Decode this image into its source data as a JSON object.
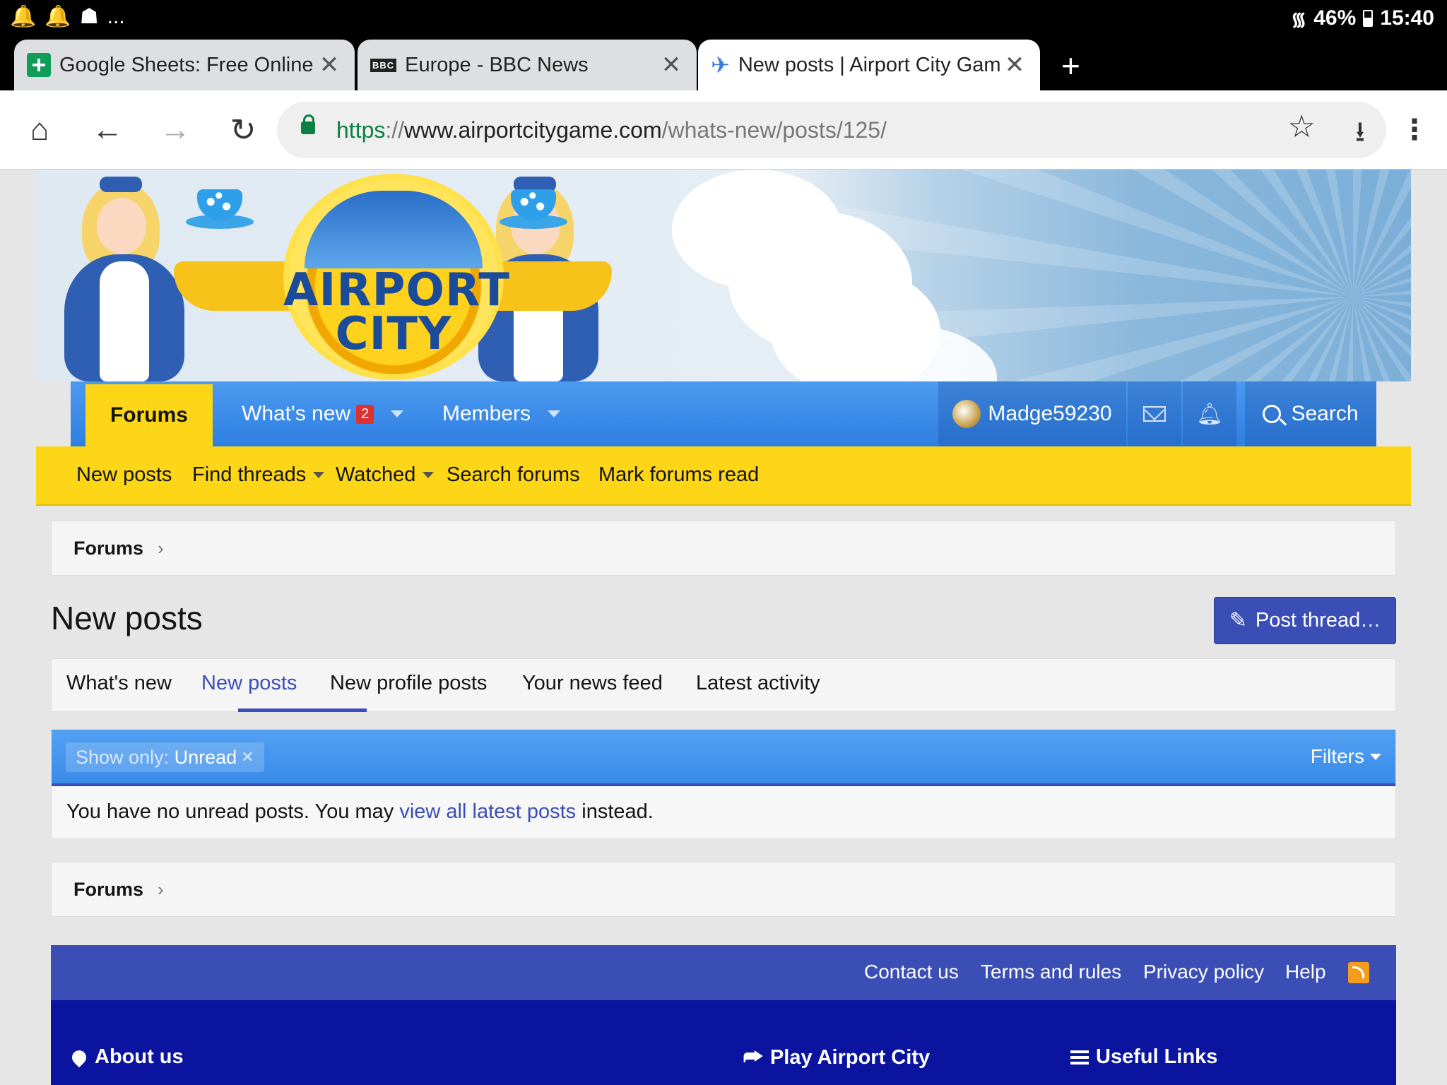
{
  "status_bar": {
    "left_icons": [
      "notification-bell-icon",
      "notification-bell-icon",
      "app-notification-icon"
    ],
    "more": "...",
    "battery": "46%",
    "time": "15:40"
  },
  "tabs": [
    {
      "title": "Google Sheets: Free Online S",
      "favicon": "sheets-icon"
    },
    {
      "title": "Europe - BBC News",
      "favicon": "bbc-icon",
      "favicon_text": "BBC"
    },
    {
      "title": "New posts | Airport City Gam",
      "favicon": "plane-icon"
    }
  ],
  "toolbar": {
    "url_scheme": "https",
    "url_sep": "://",
    "url_host": "www.airportcitygame.com",
    "url_path": "/whats-new/posts/125/"
  },
  "banner": {
    "logo_line1": "AIRPORT",
    "logo_line2": "CITY"
  },
  "nav": {
    "forums": "Forums",
    "whats_new": "What's new",
    "whats_new_badge": "2",
    "members": "Members",
    "username": "Madge59230",
    "search": "Search"
  },
  "subnav": {
    "new_posts": "New posts",
    "find_threads": "Find threads",
    "watched": "Watched",
    "search_forums": "Search forums",
    "mark_read": "Mark forums read"
  },
  "breadcrumb": {
    "label": "Forums"
  },
  "page": {
    "title": "New posts",
    "post_thread": "Post thread…"
  },
  "page_tabs": [
    {
      "label": "What's new"
    },
    {
      "label": "New posts",
      "active": true
    },
    {
      "label": "New profile posts"
    },
    {
      "label": "Your news feed"
    },
    {
      "label": "Latest activity"
    }
  ],
  "filter": {
    "chip_label": "Show only:",
    "chip_value": "Unread",
    "filters": "Filters",
    "msg_before": "You have no unread posts. You may ",
    "msg_link": "view all latest posts",
    "msg_after": " instead."
  },
  "footer": {
    "links": [
      "Contact us",
      "Terms and rules",
      "Privacy policy",
      "Help"
    ],
    "about": "About us",
    "play": "Play Airport City",
    "useful": "Useful Links"
  },
  "colors": {
    "accent_yellow": "#fcd617",
    "nav_blue": "#3a8be9",
    "brand_indigo": "#3a4eb5",
    "footer_navy": "#0b149e"
  }
}
